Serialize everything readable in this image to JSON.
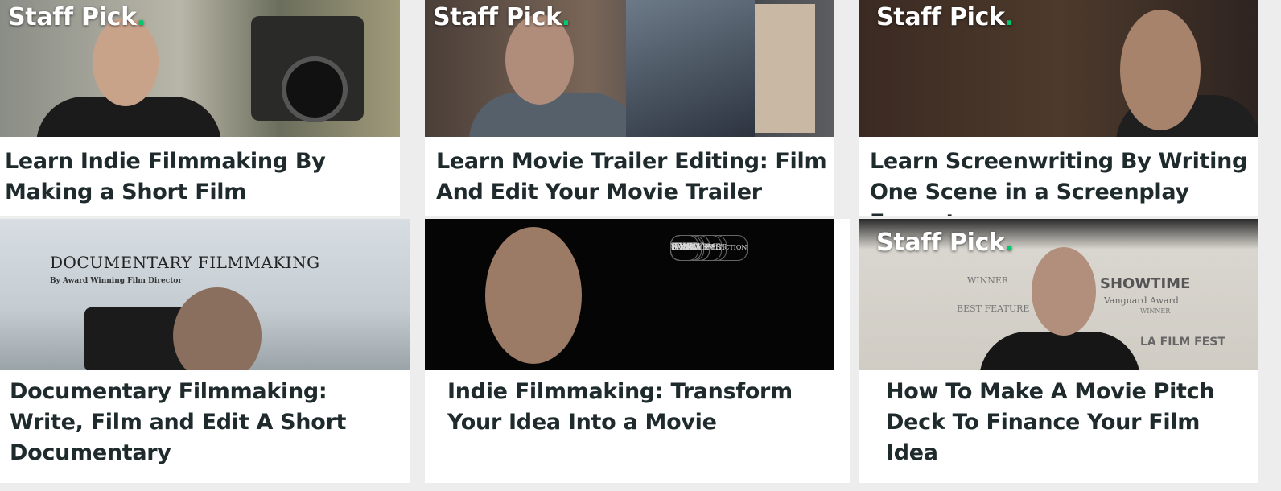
{
  "staff_pick": {
    "text": "Staff Pick",
    "dot": ".",
    "accent": "#00c86e"
  },
  "courses": [
    {
      "title": "Learn Indie Filmmaking By Making a Short Film",
      "staff_pick": true
    },
    {
      "title": "Learn Movie Trailer Editing: Film And Edit Your Movie Trailer",
      "staff_pick": true
    },
    {
      "title": "Learn Screenwriting By Writing One Scene in a Screenplay Format",
      "staff_pick": true
    },
    {
      "title": "Documentary Filmmaking: Write, Film and Edit A Short Documentary",
      "staff_pick": false,
      "thumb_heading": "DOCUMENTARY FILMMAKING",
      "thumb_sub": "By Award Winning Film Director"
    },
    {
      "title": "Indie Filmmaking: Transform Your Idea Into a Movie",
      "staff_pick": false,
      "badges": [
        "SXSW",
        "EXIT",
        "WINNER",
        "OFFICIAL SELECTION",
        "WINNER",
        "SHOWTIME",
        "TEDDY",
        "LA FILM FEST"
      ]
    },
    {
      "title": "How To Make A Movie Pitch Deck To Finance Your Film Idea",
      "staff_pick": true,
      "thumb_badges": [
        "WINNER",
        "BEST FEATURE",
        "SHOWTIME",
        "Vanguard Award",
        "WINNER",
        "LA FILM FEST"
      ]
    }
  ]
}
